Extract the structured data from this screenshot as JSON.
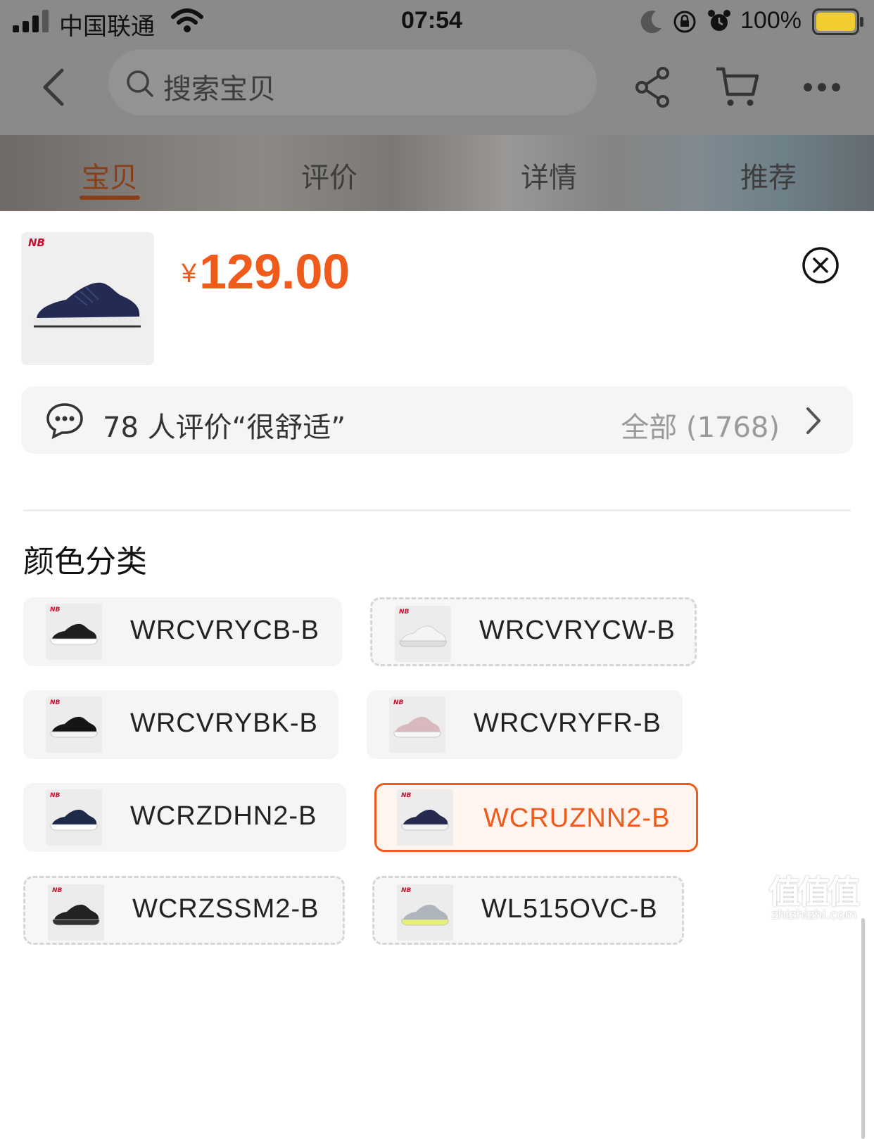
{
  "status_bar": {
    "carrier": "中国联通",
    "time": "07:54",
    "battery": "100%"
  },
  "nav": {
    "search_placeholder": "搜索宝贝",
    "tabs": [
      {
        "label": "宝贝",
        "active": true
      },
      {
        "label": "评价",
        "active": false
      },
      {
        "label": "详情",
        "active": false
      },
      {
        "label": "推荐",
        "active": false
      }
    ]
  },
  "product": {
    "currency": "¥",
    "price": "129.00",
    "brand_logo_text": "NB"
  },
  "review": {
    "summary": "78 人评价“很舒适”",
    "all_label": "全部 (1768)"
  },
  "options": {
    "title": "颜色分类",
    "items": [
      {
        "label": "WRCVRYCB-B",
        "state": "normal",
        "shoe_color": "#1e1e1e",
        "sole_color": "#ffffff"
      },
      {
        "label": "WRCVRYCW-B",
        "state": "unavailable",
        "shoe_color": "#f4f4f4",
        "sole_color": "#dedede"
      },
      {
        "label": "WRCVRYBK-B",
        "state": "normal",
        "shoe_color": "#151515",
        "sole_color": "#f2f2f2"
      },
      {
        "label": "WRCVRYFR-B",
        "state": "normal",
        "shoe_color": "#d9b9bd",
        "sole_color": "#f6f6f6"
      },
      {
        "label": "WCRZDHN2-B",
        "state": "normal",
        "shoe_color": "#1d2a4a",
        "sole_color": "#ffffff"
      },
      {
        "label": "WCRUZNN2-B",
        "state": "selected",
        "shoe_color": "#262a50",
        "sole_color": "#f2f2f2"
      },
      {
        "label": "WCRZSSM2-B",
        "state": "unavailable",
        "shoe_color": "#222222",
        "sole_color": "#333333"
      },
      {
        "label": "WL515OVC-B",
        "state": "unavailable",
        "shoe_color": "#aeb5bc",
        "sole_color": "#e6f07a"
      }
    ]
  },
  "watermark": {
    "big": "值值值",
    "small": "zhizhizhi.com"
  },
  "colors": {
    "accent": "#f05a1a",
    "dim_overlay": "#8a8a8a",
    "chip_bg": "#f5f5f5"
  }
}
